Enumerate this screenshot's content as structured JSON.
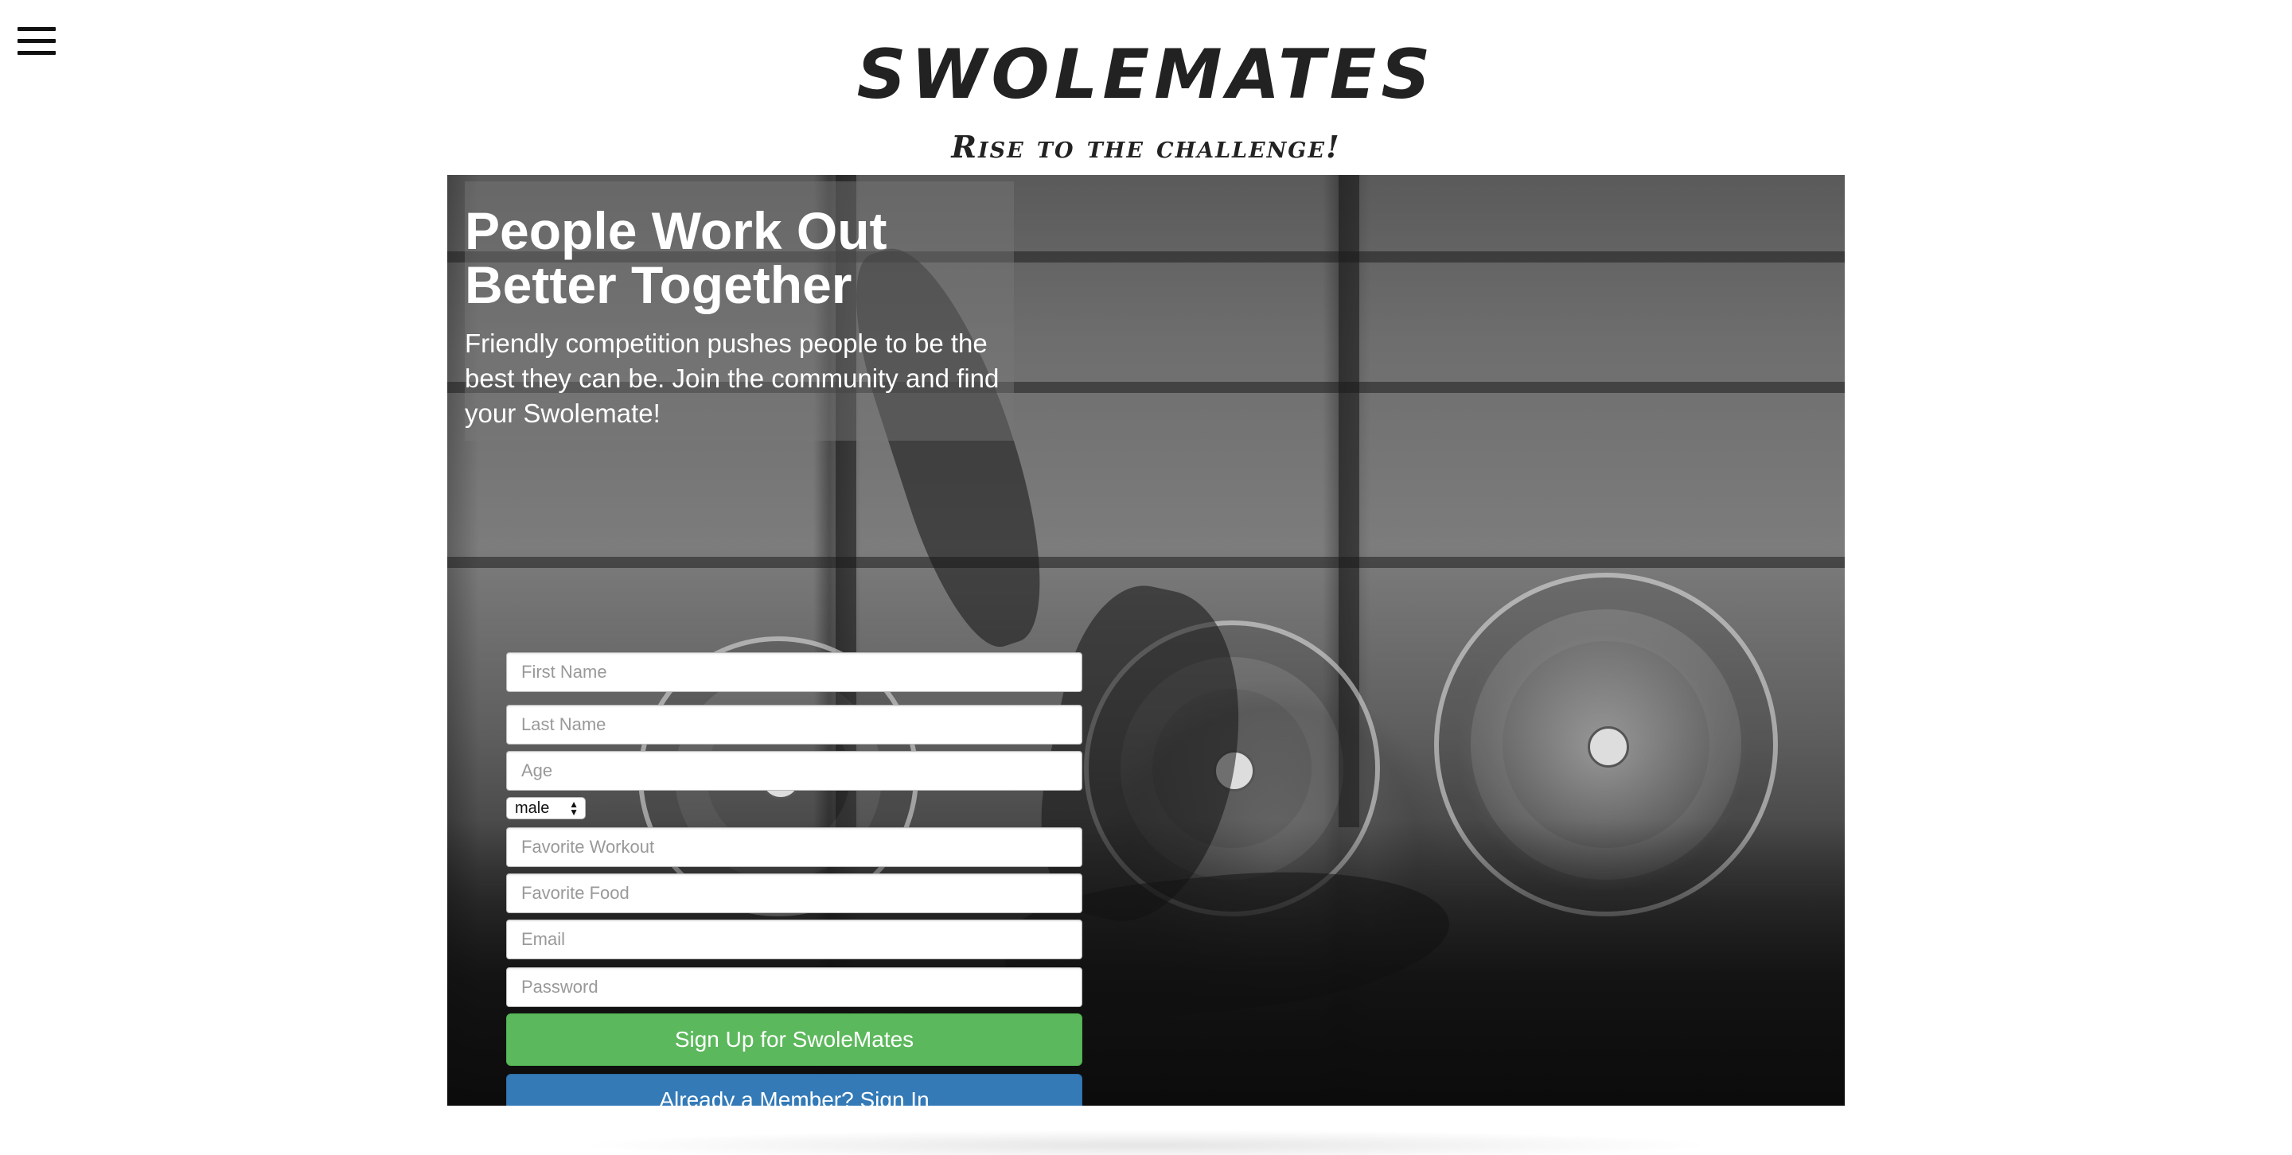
{
  "header": {
    "brand": "SWOLEMATES",
    "tagline": "Rise to the challenge!",
    "menu_icon": "hamburger-menu-icon"
  },
  "hero": {
    "headline_line1": "People Work Out",
    "headline_line2": "Better Together",
    "subtext": "Friendly competition pushes people to be the best they can be. Join the community and find your Swolemate!"
  },
  "form": {
    "first_name_placeholder": "First Name",
    "last_name_placeholder": "Last Name",
    "age_placeholder": "Age",
    "gender_selected": "male",
    "favorite_workout_placeholder": "Favorite Workout",
    "favorite_food_placeholder": "Favorite Food",
    "email_placeholder": "Email",
    "password_placeholder": "Password",
    "signup_label": "Sign Up for SwoleMates",
    "signin_label": "Already a Member? Sign In"
  },
  "colors": {
    "signup_button": "#5cb85c",
    "signin_button": "#337ab7",
    "brand_text": "#222222"
  }
}
